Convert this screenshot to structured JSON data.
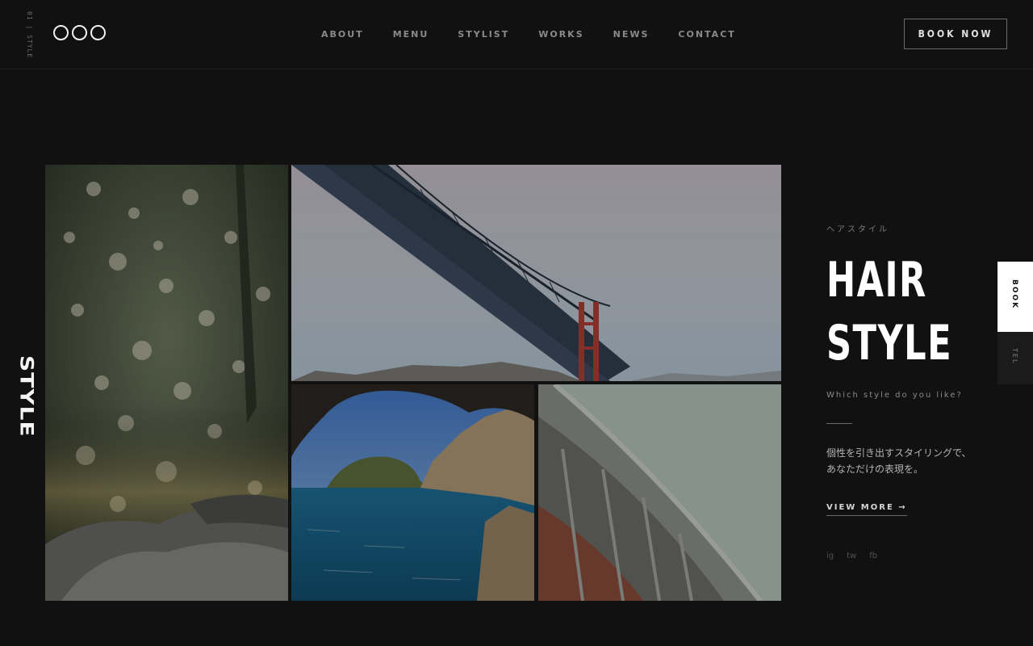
{
  "header": {
    "index_label": "01 | STYLE",
    "logo": "○○○",
    "nav": [
      "ABOUT",
      "MENU",
      "STYLIST",
      "WORKS",
      "NEWS",
      "CONTACT"
    ],
    "book_button": "BOOK NOW"
  },
  "side_label": "STYLE",
  "gallery": {
    "photos": [
      "forest-bokeh",
      "golden-gate-bridge",
      "sea-cave-coast",
      "curved-architecture"
    ]
  },
  "info": {
    "kana": "ヘアスタイル",
    "title_line1": "HAIR",
    "title_line2": "STYLE",
    "question": "Which style do you like?",
    "desc_line1": "個性を引き出すスタイリングで、",
    "desc_line2": "あなただけの表現を。",
    "view_more": "VIEW MORE →",
    "social": [
      "ig",
      "tw",
      "fb"
    ]
  },
  "side_tabs": {
    "book": "BOOK",
    "tel": "TEL"
  },
  "colors": {
    "background": "#111111",
    "text": "#ffffff",
    "muted": "#8a8a8a"
  }
}
